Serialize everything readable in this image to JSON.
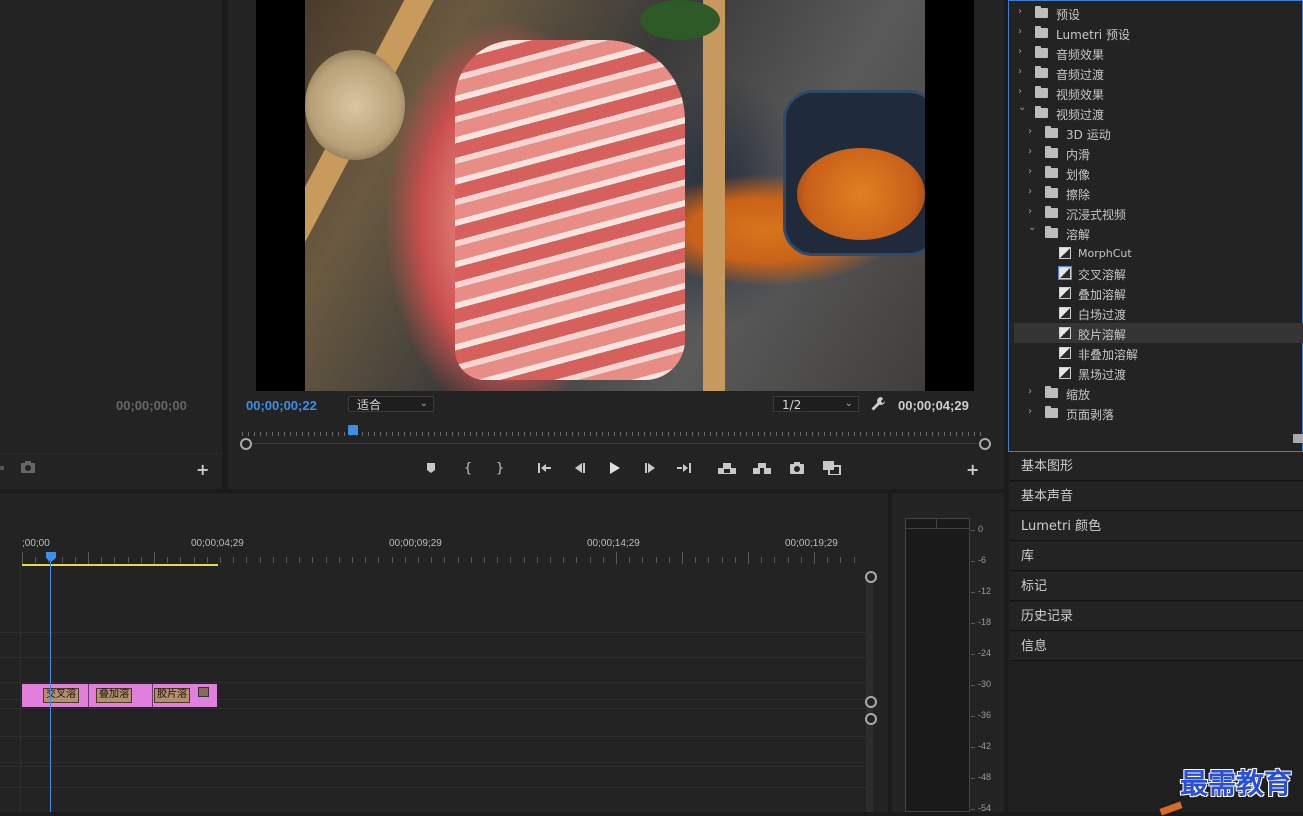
{
  "source_monitor": {
    "timecode": "00;00;00;00"
  },
  "program_monitor": {
    "current_timecode": "00;00;00;22",
    "fit_select": "适合",
    "resolution_select": "1/2",
    "duration_timecode": "00;00;04;29",
    "playhead_fraction": 0.15
  },
  "transport": {
    "add_marker": "marker",
    "mark_in": "{",
    "mark_out": "}",
    "go_to_in": "go-to-in",
    "step_back": "step-back",
    "play": "play",
    "step_forward": "step-forward",
    "go_to_out": "go-to-out",
    "lift": "lift",
    "extract": "extract",
    "export_frame": "camera",
    "compare": "compare",
    "add": "+"
  },
  "effects_tree": [
    {
      "indent": 0,
      "type": "folder",
      "expanded": false,
      "label": "预设",
      "special": true
    },
    {
      "indent": 0,
      "type": "folder",
      "expanded": false,
      "label": "Lumetri 预设",
      "special": true
    },
    {
      "indent": 0,
      "type": "folder",
      "expanded": false,
      "label": "音频效果"
    },
    {
      "indent": 0,
      "type": "folder",
      "expanded": false,
      "label": "音频过渡"
    },
    {
      "indent": 0,
      "type": "folder",
      "expanded": false,
      "label": "视频效果"
    },
    {
      "indent": 0,
      "type": "folder",
      "expanded": true,
      "label": "视频过渡"
    },
    {
      "indent": 1,
      "type": "folder",
      "expanded": false,
      "label": "3D 运动"
    },
    {
      "indent": 1,
      "type": "folder",
      "expanded": false,
      "label": "内滑"
    },
    {
      "indent": 1,
      "type": "folder",
      "expanded": false,
      "label": "划像"
    },
    {
      "indent": 1,
      "type": "folder",
      "expanded": false,
      "label": "擦除"
    },
    {
      "indent": 1,
      "type": "folder",
      "expanded": false,
      "label": "沉浸式视频"
    },
    {
      "indent": 1,
      "type": "folder",
      "expanded": true,
      "label": "溶解"
    },
    {
      "indent": 2,
      "type": "effect",
      "label": "MorphCut"
    },
    {
      "indent": 2,
      "type": "effect",
      "label": "交叉溶解",
      "highlight": true
    },
    {
      "indent": 2,
      "type": "effect",
      "label": "叠加溶解"
    },
    {
      "indent": 2,
      "type": "effect",
      "label": "白场过渡"
    },
    {
      "indent": 2,
      "type": "effect",
      "label": "胶片溶解",
      "selected": true
    },
    {
      "indent": 2,
      "type": "effect",
      "label": "非叠加溶解"
    },
    {
      "indent": 2,
      "type": "effect",
      "label": "黑场过渡"
    },
    {
      "indent": 1,
      "type": "folder",
      "expanded": false,
      "label": "缩放"
    },
    {
      "indent": 1,
      "type": "folder",
      "expanded": false,
      "label": "页面剥落"
    }
  ],
  "side_panels": [
    "基本图形",
    "基本声音",
    "Lumetri 颜色",
    "库",
    "标记",
    "历史记录",
    "信息"
  ],
  "timeline": {
    "ruler_labels": [
      ";00;00",
      "00;00;04;29",
      "00;00;09;29",
      "00;00;14;29",
      "00;00;19;29"
    ],
    "clips": [
      {
        "label": "交叉溶"
      },
      {
        "label": "叠加溶"
      },
      {
        "label": "胶片溶"
      }
    ],
    "clip_color": "#e07fde",
    "work_area_color": "#e8d84a",
    "playhead_color": "#3d8fe8"
  },
  "audio_meter": {
    "scale": [
      "0",
      "-6",
      "-12",
      "-18",
      "-24",
      "-30",
      "-36",
      "-42",
      "-48",
      "-54"
    ]
  },
  "watermark": "最需教育",
  "colors": {
    "accent_blue": "#3d8fe8",
    "timecode_blue": "#3d8fe8",
    "panel_bg": "#232323",
    "active_border": "#3d7fd0"
  }
}
